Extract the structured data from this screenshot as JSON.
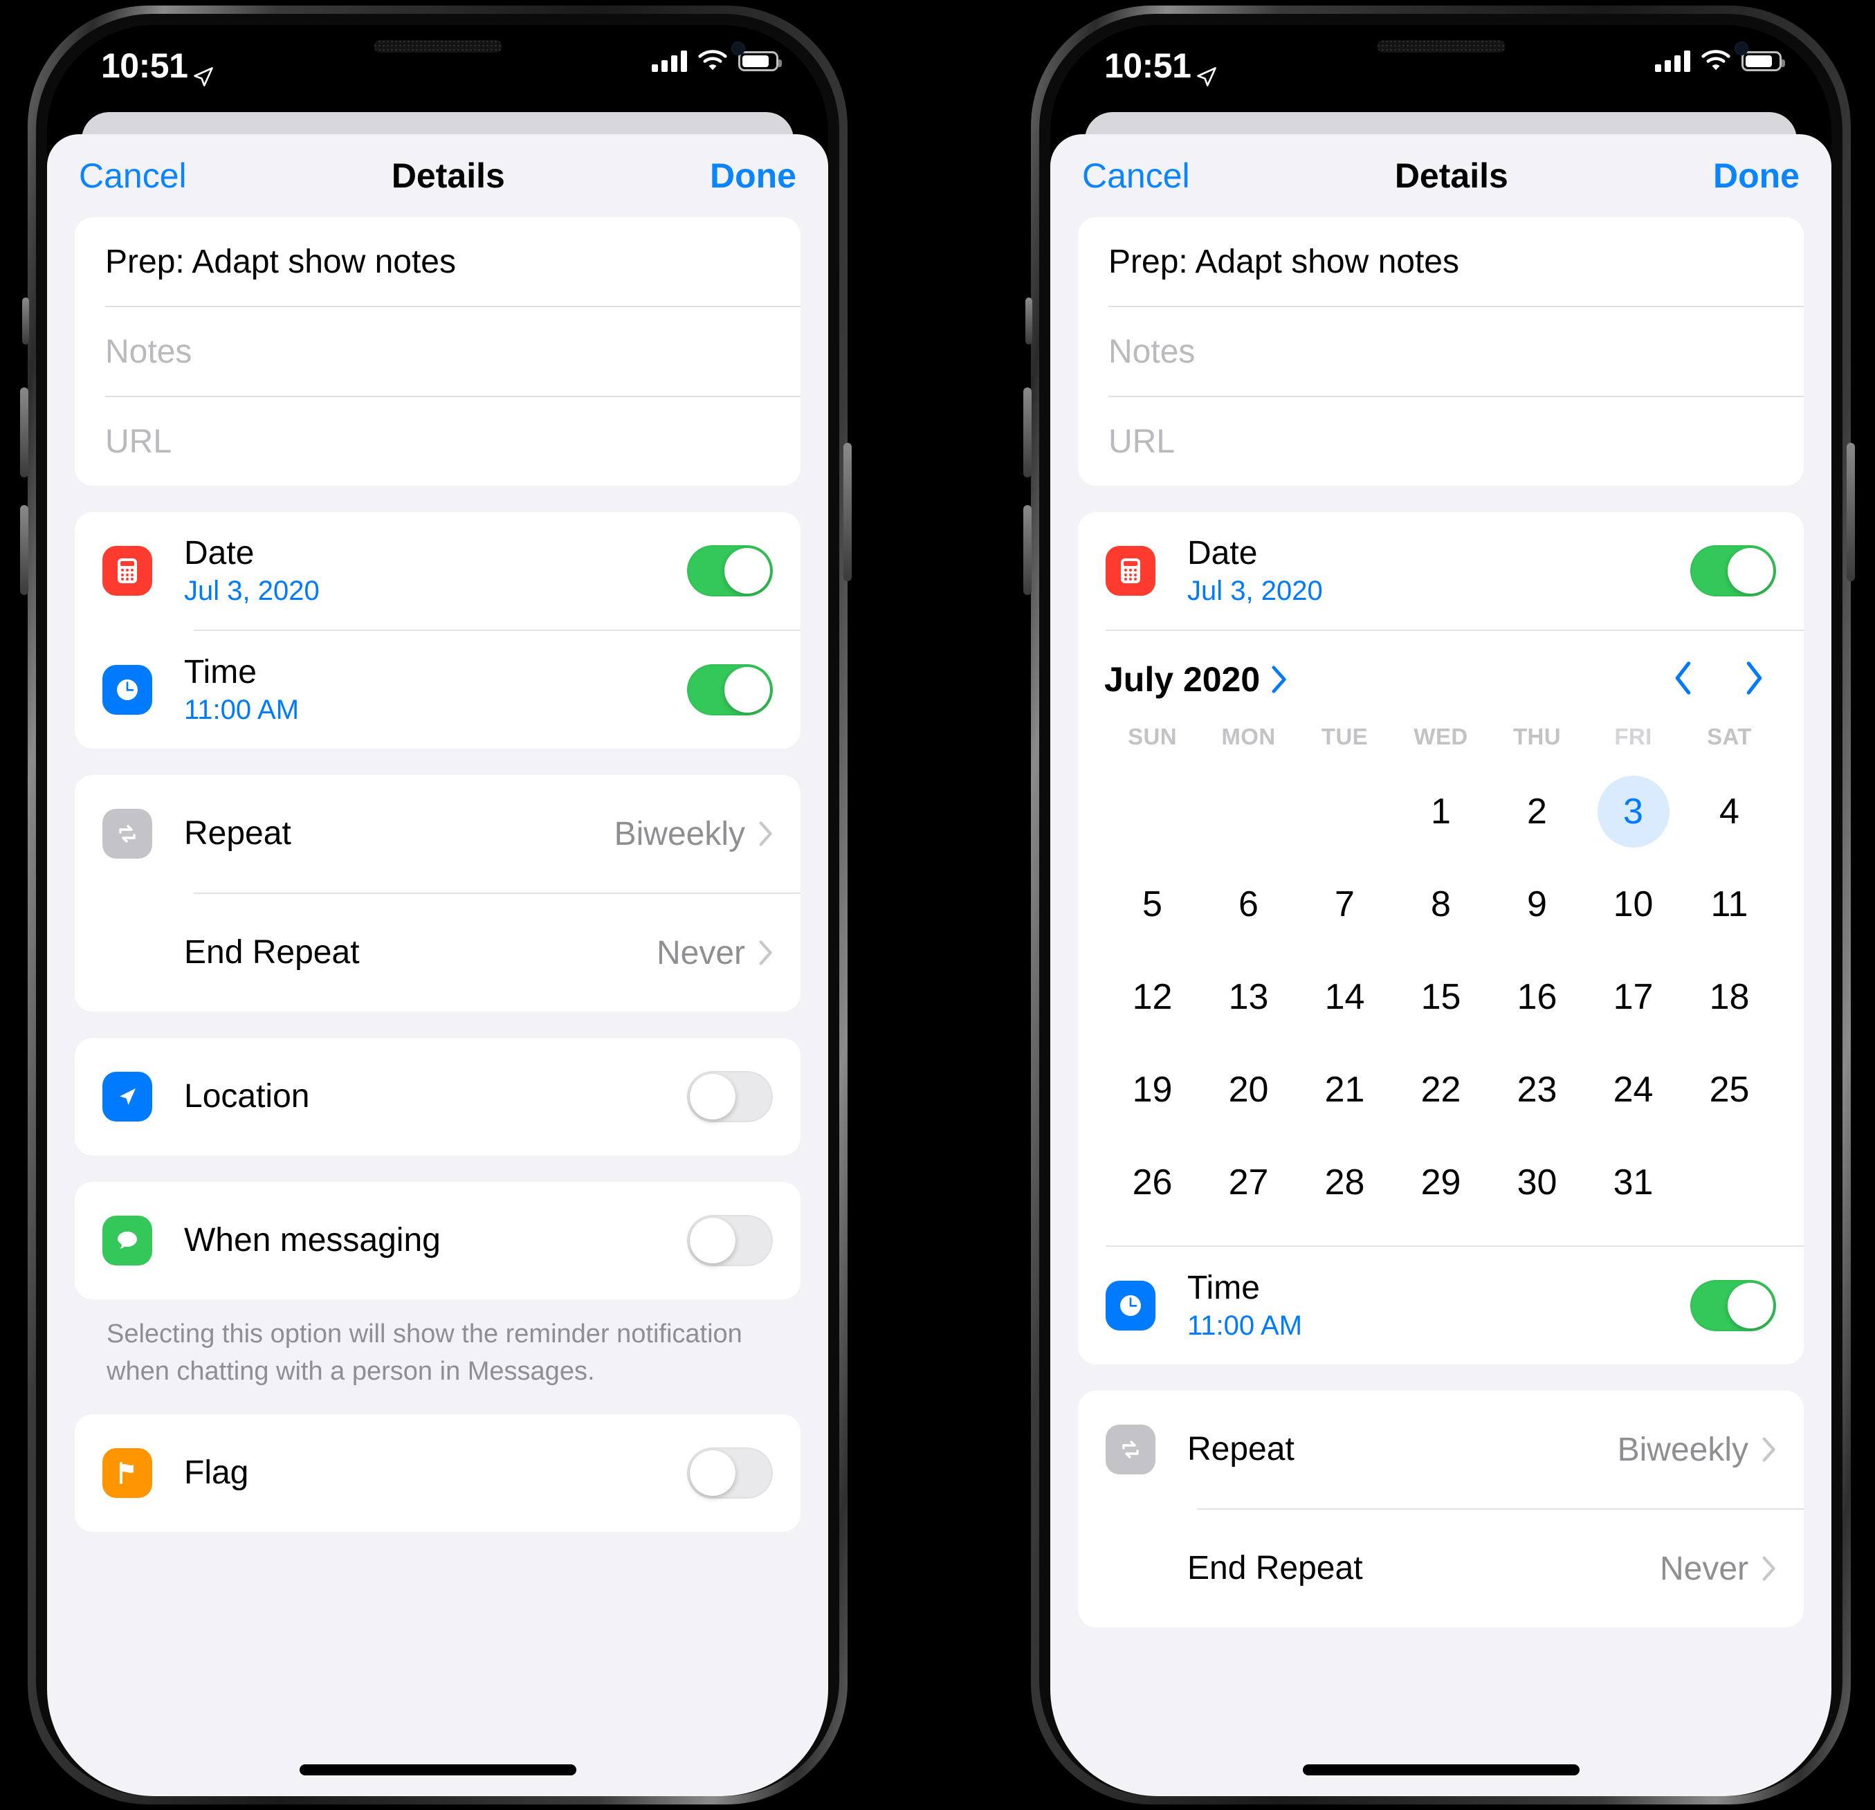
{
  "status_bar": {
    "time": "10:51",
    "location_icon": "location-arrow-icon",
    "signal_icon": "cellular-signal-icon",
    "wifi_icon": "wifi-icon",
    "battery_icon": "battery-icon"
  },
  "nav": {
    "cancel": "Cancel",
    "title": "Details",
    "done": "Done"
  },
  "fields": {
    "title_value": "Prep: Adapt show notes",
    "notes_placeholder": "Notes",
    "url_placeholder": "URL"
  },
  "rows": {
    "date": {
      "label": "Date",
      "value": "Jul 3, 2020",
      "toggle": "on",
      "icon": "calendar-icon"
    },
    "time": {
      "label": "Time",
      "value": "11:00 AM",
      "toggle": "on",
      "icon": "clock-icon"
    },
    "repeat": {
      "label": "Repeat",
      "value": "Biweekly",
      "icon": "repeat-icon"
    },
    "end_repeat": {
      "label": "End Repeat",
      "value": "Never"
    },
    "location": {
      "label": "Location",
      "toggle": "off",
      "icon": "navigation-arrow-icon"
    },
    "messaging": {
      "label": "When messaging",
      "toggle": "off",
      "icon": "message-bubble-icon"
    },
    "flag": {
      "label": "Flag",
      "toggle": "off",
      "icon": "flag-icon"
    }
  },
  "footnote": "Selecting this option will show the reminder notification when chatting with a person in Messages.",
  "calendar": {
    "month_label": "July 2020",
    "disclosure_icon": "chevron-right-icon",
    "prev_icon": "chevron-left-icon",
    "next_icon": "chevron-right-icon",
    "weekdays": [
      "SUN",
      "MON",
      "TUE",
      "WED",
      "THU",
      "FRI",
      "SAT"
    ],
    "leading_blanks": 3,
    "days": [
      1,
      2,
      3,
      4,
      5,
      6,
      7,
      8,
      9,
      10,
      11,
      12,
      13,
      14,
      15,
      16,
      17,
      18,
      19,
      20,
      21,
      22,
      23,
      24,
      25,
      26,
      27,
      28,
      29,
      30,
      31
    ],
    "selected_day": 3,
    "selected_weekday": "FRI"
  },
  "colors": {
    "accent_blue": "#007aff",
    "nav_blue": "#0a84ff",
    "toggle_green": "#34c759",
    "icon_red": "#ff3b30",
    "icon_blue": "#007aff",
    "icon_gray": "#c4c4c8",
    "icon_green": "#34c759",
    "icon_orange": "#ff9500",
    "secondary_text": "#8e8e93",
    "sheet_bg": "#f2f2f7",
    "selected_day_bg": "#d9ebfd"
  }
}
